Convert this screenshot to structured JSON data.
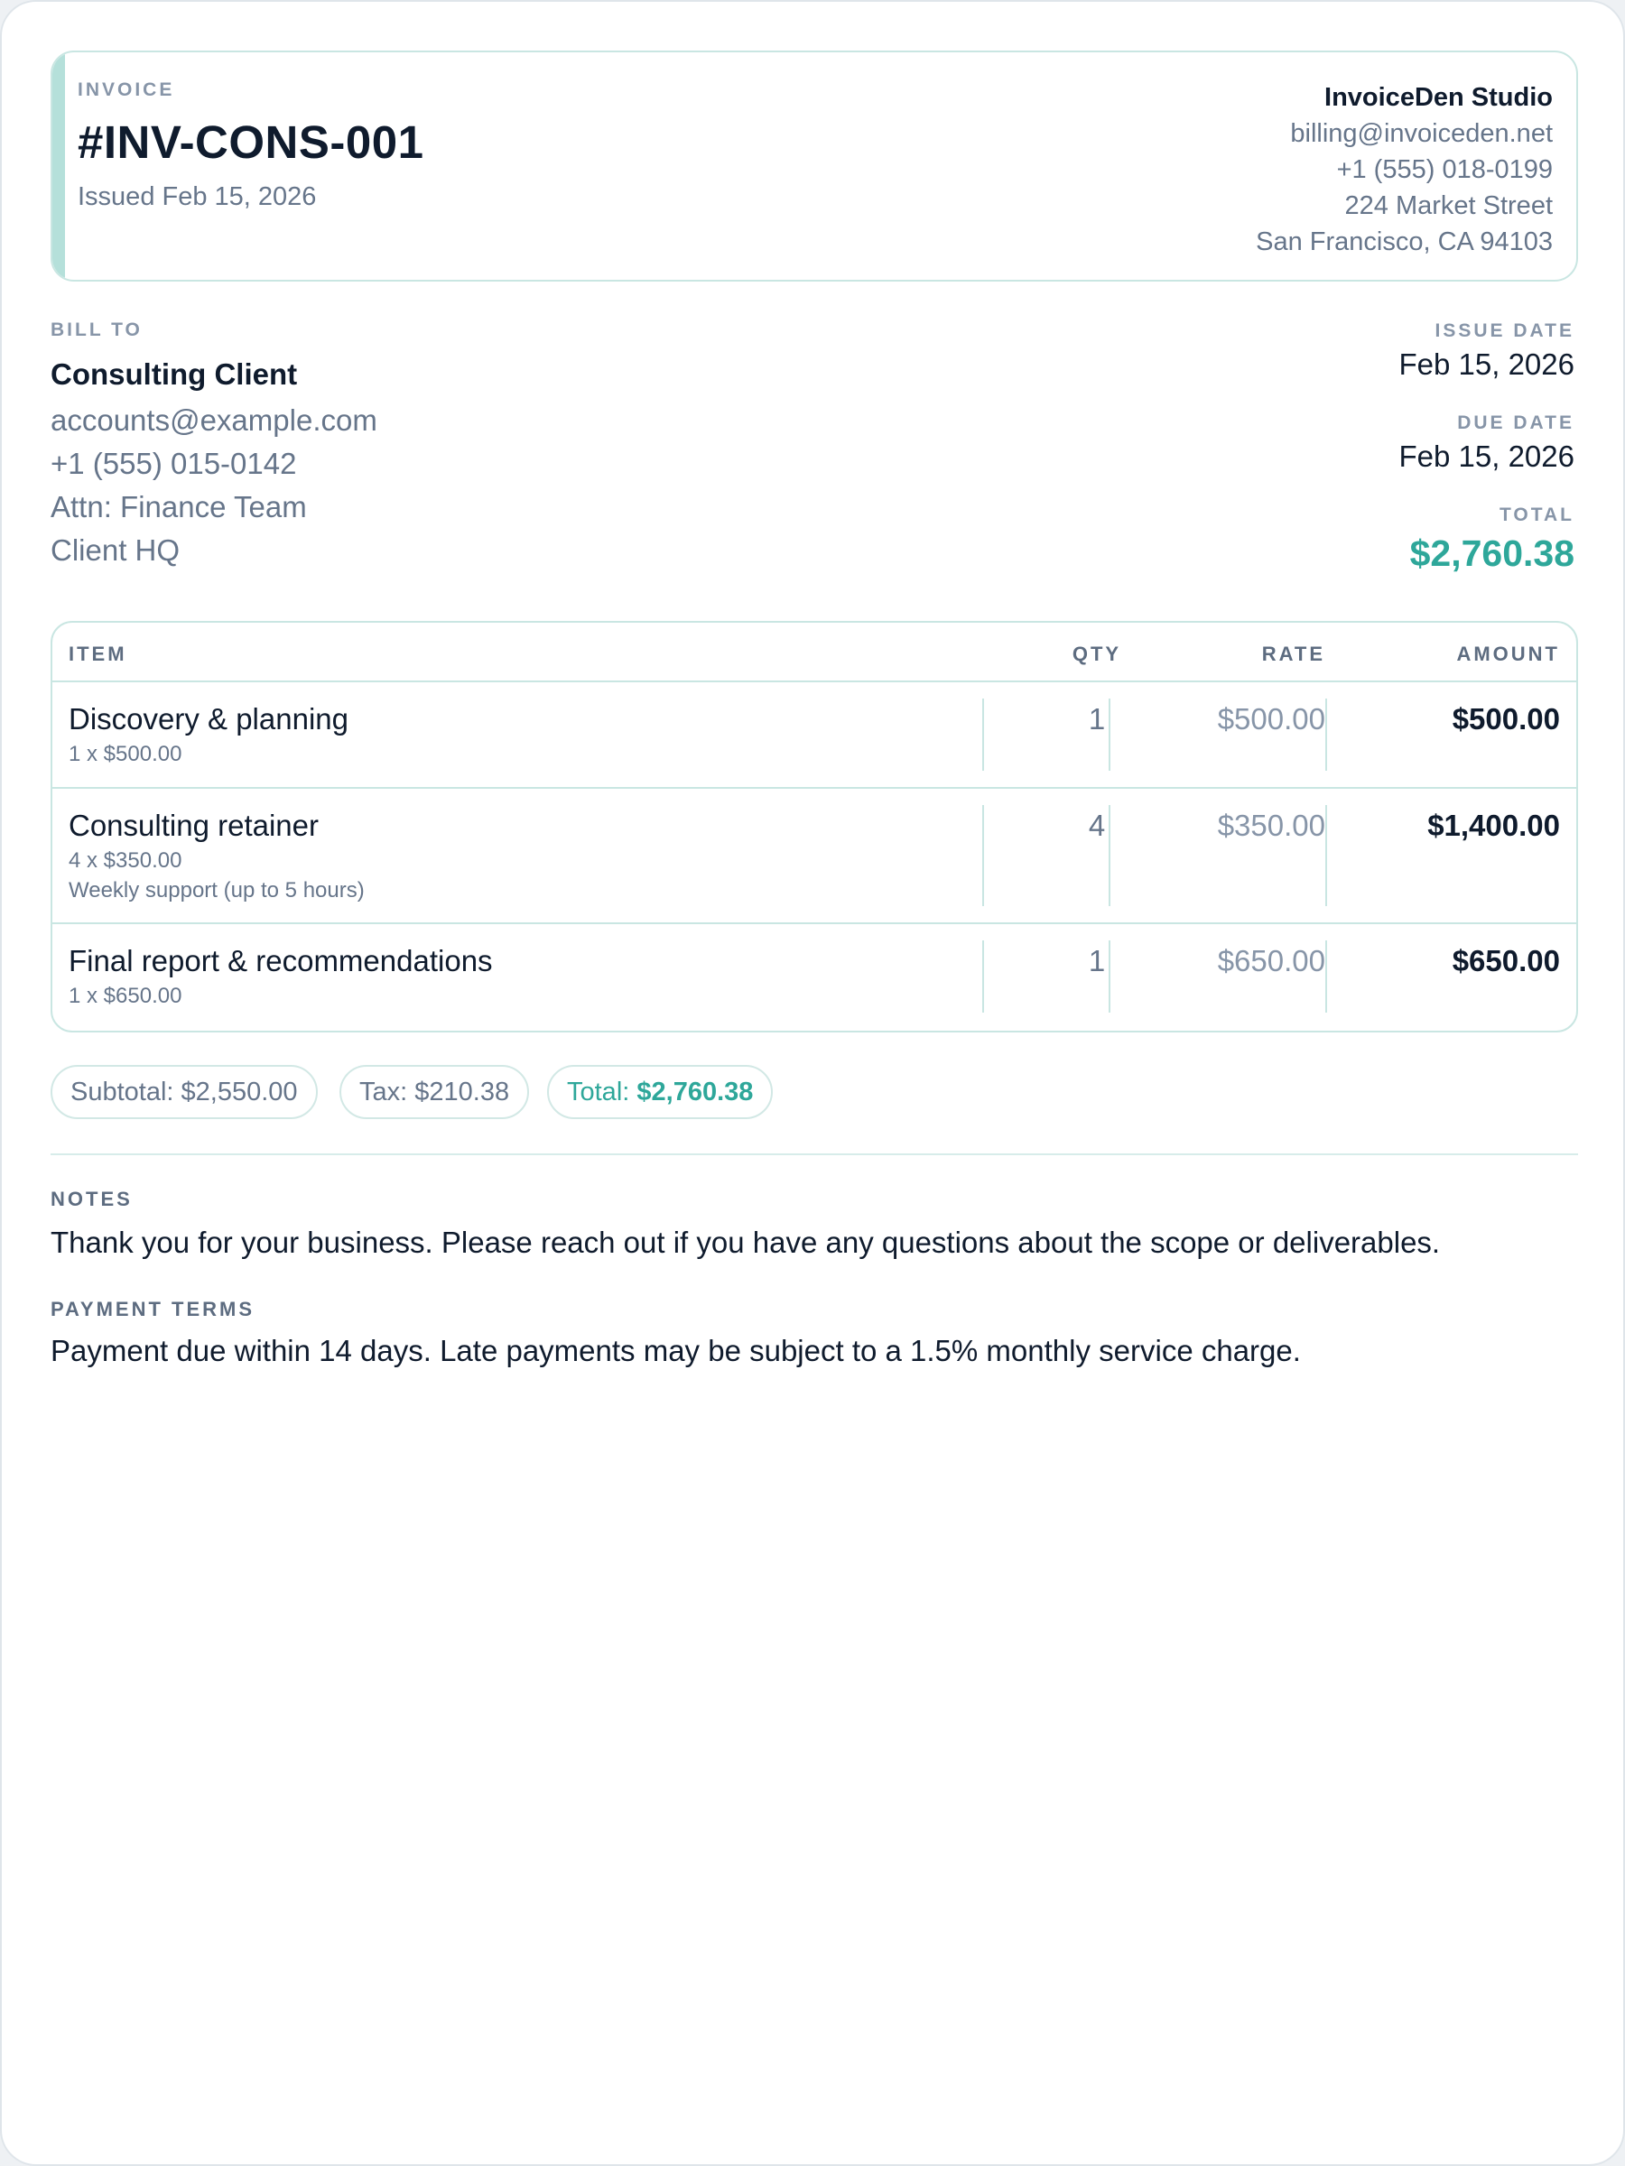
{
  "invoice": {
    "label": "INVOICE",
    "number": "#INV-CONS-001",
    "issued": "Issued Feb 15, 2026"
  },
  "company": {
    "name": "InvoiceDen Studio",
    "email": "billing@invoiceden.net",
    "phone": "+1 (555) 018-0199",
    "street": "224 Market Street",
    "city": "San Francisco, CA 94103"
  },
  "bill_to": {
    "label": "BILL TO",
    "name": "Consulting Client",
    "email": "accounts@example.com",
    "phone": "+1 (555) 015-0142",
    "attn": "Attn: Finance Team",
    "location": "Client HQ"
  },
  "meta": {
    "issue_date_label": "ISSUE DATE",
    "issue_date": "Feb 15, 2026",
    "due_date_label": "DUE DATE",
    "due_date": "Feb 15, 2026",
    "total_label": "TOTAL",
    "total": "$2,760.38"
  },
  "table": {
    "headers": {
      "item": "ITEM",
      "qty": "QTY",
      "rate": "RATE",
      "amount": "AMOUNT"
    },
    "rows": [
      {
        "title": "Discovery & planning",
        "detail": "1 x $500.00",
        "note": "",
        "qty": "1",
        "rate": "$500.00",
        "amount": "$500.00"
      },
      {
        "title": "Consulting retainer",
        "detail": "4 x $350.00",
        "note": "Weekly support (up to 5 hours)",
        "qty": "4",
        "rate": "$350.00",
        "amount": "$1,400.00"
      },
      {
        "title": "Final report & recommendations",
        "detail": "1 x $650.00",
        "note": "",
        "qty": "1",
        "rate": "$650.00",
        "amount": "$650.00"
      }
    ]
  },
  "summary": {
    "subtotal": "Subtotal: $2,550.00",
    "tax": "Tax: $210.38",
    "total_label": "Total:",
    "total_value": "$2,760.38"
  },
  "notes": {
    "label": "NOTES",
    "text": "Thank you for your business. Please reach out if you have any questions about the scope or deliverables."
  },
  "payment_terms": {
    "label": "PAYMENT TERMS",
    "text": "Payment due within 14 days. Late payments may be subject to a 1.5% monthly service charge."
  },
  "colors": {
    "accent": "#2ea79a",
    "border": "#c9e6e2",
    "muted": "#66758a",
    "text": "#0f1b2d"
  }
}
